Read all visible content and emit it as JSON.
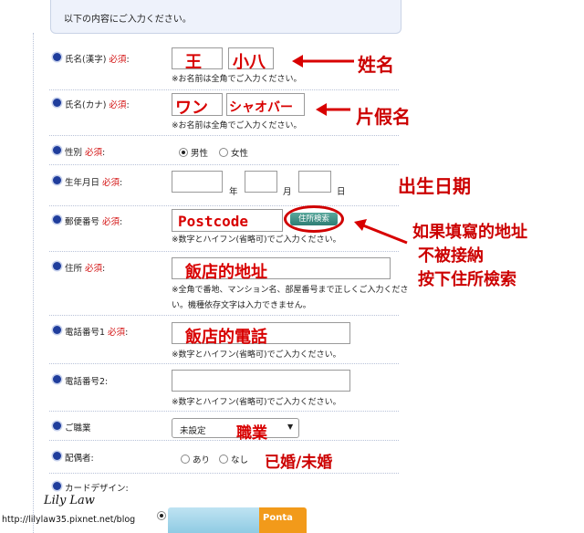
{
  "header": {
    "text": "以下の内容にご入力ください。"
  },
  "required_label": "必須",
  "fields": {
    "name_kanji": {
      "label": "氏名(漢字)",
      "last": "王",
      "first": "小八",
      "note": "※お名前は全角でご入力ください。"
    },
    "name_kana": {
      "label": "氏名(カナ)",
      "last": "ワン",
      "first": "シャオバー",
      "note": "※お名前は全角でご入力ください。"
    },
    "gender": {
      "label": "性別",
      "options": [
        "男性",
        "女性"
      ],
      "selected": "男性"
    },
    "birthday": {
      "label": "生年月日",
      "year_unit": "年",
      "month_unit": "月",
      "day_unit": "日"
    },
    "postcode": {
      "label": "郵便番号",
      "value": "Postcode",
      "button": "住所検索",
      "note": "※数字とハイフン(省略可)でご入力ください。"
    },
    "address": {
      "label": "住所",
      "value": "飯店的地址",
      "note1": "※全角で番地、マンション名、部屋番号まで正しくご入力くださ",
      "note2": "い。機種依存文字は入力できません。"
    },
    "phone1": {
      "label": "電話番号1",
      "value": "飯店的電話",
      "note": "※数字とハイフン(省略可)でご入力ください。"
    },
    "phone2": {
      "label": "電話番号2:",
      "value": "",
      "note": "※数字とハイフン(省略可)でご入力ください。"
    },
    "occupation": {
      "label": "ご職業",
      "selected": "未設定",
      "overlay": "職業"
    },
    "spouse": {
      "label": "配偶者:",
      "options": [
        "あり",
        "なし"
      ],
      "overlay": "已婚/未婚"
    },
    "card_design": {
      "label": "カードデザイン:",
      "card_text": "Ponta"
    }
  },
  "annotations": {
    "name": "姓名",
    "kana": "片假名",
    "birthday": "出生日期",
    "postcode_line1": "如果填寫的地址",
    "postcode_line2": "不被接納",
    "postcode_line3": "按下住所檢索"
  },
  "watermark": {
    "name": "Lily Law",
    "url": "http://lilylaw35.pixnet.net/blog"
  },
  "colors": {
    "accent": "#1f3d9c",
    "required": "#d31010",
    "annotation": "#cc0000",
    "button": "#2e7d74"
  }
}
